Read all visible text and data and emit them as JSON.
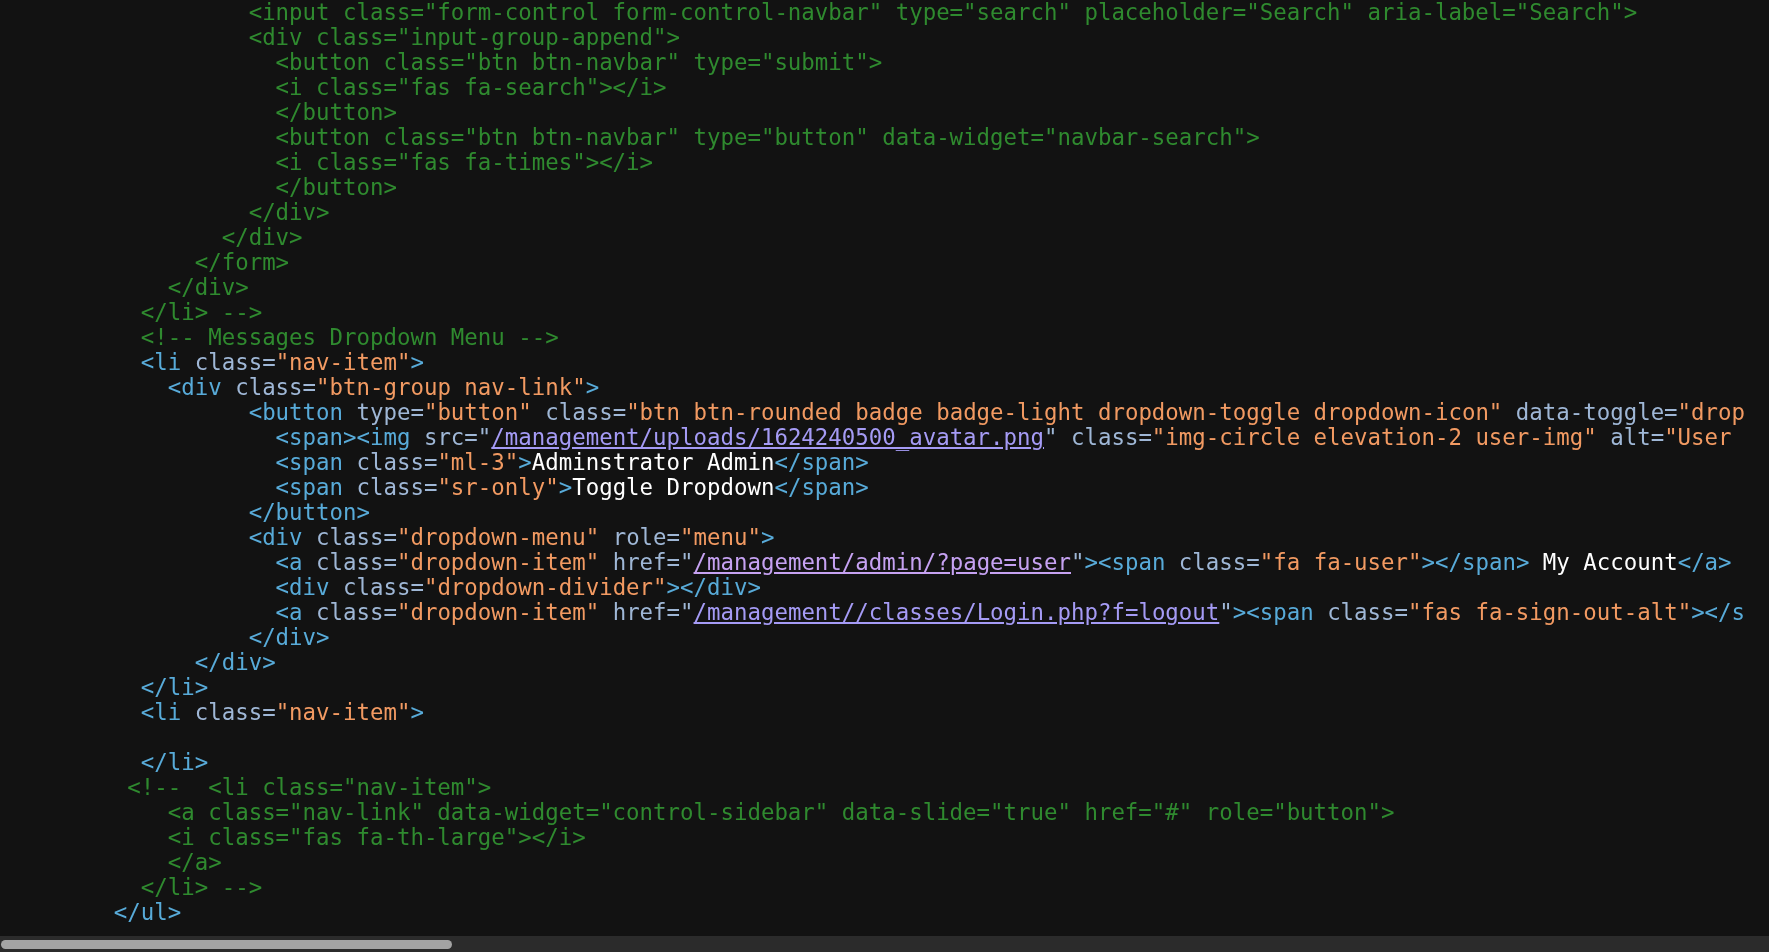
{
  "source_view": {
    "lines": [
      {
        "segments": [
          {
            "kind": "comment",
            "text": "                  <input class=\"form-control form-control-navbar\" type=\"search\" placeholder=\"Search\" aria-label=\"Search\">"
          }
        ]
      },
      {
        "segments": [
          {
            "kind": "comment",
            "text": "                  <div class=\"input-group-append\">"
          }
        ]
      },
      {
        "segments": [
          {
            "kind": "comment",
            "text": "                    <button class=\"btn btn-navbar\" type=\"submit\">"
          }
        ]
      },
      {
        "segments": [
          {
            "kind": "comment",
            "text": "                    <i class=\"fas fa-search\"></i>"
          }
        ]
      },
      {
        "segments": [
          {
            "kind": "comment",
            "text": "                    </button>"
          }
        ]
      },
      {
        "segments": [
          {
            "kind": "comment",
            "text": "                    <button class=\"btn btn-navbar\" type=\"button\" data-widget=\"navbar-search\">"
          }
        ]
      },
      {
        "segments": [
          {
            "kind": "comment",
            "text": "                    <i class=\"fas fa-times\"></i>"
          }
        ]
      },
      {
        "segments": [
          {
            "kind": "comment",
            "text": "                    </button>"
          }
        ]
      },
      {
        "segments": [
          {
            "kind": "comment",
            "text": "                  </div>"
          }
        ]
      },
      {
        "segments": [
          {
            "kind": "comment",
            "text": "                </div>"
          }
        ]
      },
      {
        "segments": [
          {
            "kind": "comment",
            "text": "              </form>"
          }
        ]
      },
      {
        "segments": [
          {
            "kind": "comment",
            "text": "            </div>"
          }
        ]
      },
      {
        "segments": [
          {
            "kind": "comment",
            "text": "          </li> -->"
          }
        ]
      },
      {
        "segments": [
          {
            "kind": "comment",
            "text": "          <!-- Messages Dropdown Menu -->"
          }
        ]
      },
      {
        "segments": [
          {
            "kind": "tag",
            "text": "          <li"
          },
          {
            "kind": "attr",
            "text": " class="
          },
          {
            "kind": "value",
            "text": "\"nav-item\""
          },
          {
            "kind": "tag",
            "text": ">"
          }
        ]
      },
      {
        "segments": [
          {
            "kind": "tag",
            "text": "            <div"
          },
          {
            "kind": "attr",
            "text": " class="
          },
          {
            "kind": "value",
            "text": "\"btn-group nav-link\""
          },
          {
            "kind": "tag",
            "text": ">"
          }
        ]
      },
      {
        "segments": [
          {
            "kind": "tag",
            "text": "                  <button"
          },
          {
            "kind": "attr",
            "text": " type="
          },
          {
            "kind": "value",
            "text": "\"button\""
          },
          {
            "kind": "attr",
            "text": " class="
          },
          {
            "kind": "value",
            "text": "\"btn btn-rounded badge badge-light dropdown-toggle dropdown-icon\""
          },
          {
            "kind": "attr",
            "text": " data-toggle="
          },
          {
            "kind": "value",
            "text": "\"drop"
          }
        ]
      },
      {
        "segments": [
          {
            "kind": "tag",
            "text": "                    <span><img"
          },
          {
            "kind": "attr",
            "text": " src=\""
          },
          {
            "kind": "link",
            "text": "/management/uploads/1624240500_avatar.png"
          },
          {
            "kind": "attr",
            "text": "\" class="
          },
          {
            "kind": "value",
            "text": "\"img-circle elevation-2 user-img\""
          },
          {
            "kind": "attr",
            "text": " alt="
          },
          {
            "kind": "value",
            "text": "\"User"
          }
        ]
      },
      {
        "segments": [
          {
            "kind": "tag",
            "text": "                    <span"
          },
          {
            "kind": "attr",
            "text": " class="
          },
          {
            "kind": "value",
            "text": "\"ml-3\""
          },
          {
            "kind": "tag",
            "text": ">"
          },
          {
            "kind": "text",
            "text": "Adminstrator Admin"
          },
          {
            "kind": "tag",
            "text": "</span>"
          }
        ]
      },
      {
        "segments": [
          {
            "kind": "tag",
            "text": "                    <span"
          },
          {
            "kind": "attr",
            "text": " class="
          },
          {
            "kind": "value",
            "text": "\"sr-only\""
          },
          {
            "kind": "tag",
            "text": ">"
          },
          {
            "kind": "text",
            "text": "Toggle Dropdown"
          },
          {
            "kind": "tag",
            "text": "</span>"
          }
        ]
      },
      {
        "segments": [
          {
            "kind": "tag",
            "text": "                  </button>"
          }
        ]
      },
      {
        "segments": [
          {
            "kind": "tag",
            "text": "                  <div"
          },
          {
            "kind": "attr",
            "text": " class="
          },
          {
            "kind": "value",
            "text": "\"dropdown-menu\""
          },
          {
            "kind": "attr",
            "text": " role="
          },
          {
            "kind": "value",
            "text": "\"menu\""
          },
          {
            "kind": "tag",
            "text": ">"
          }
        ]
      },
      {
        "segments": [
          {
            "kind": "tag",
            "text": "                    <a"
          },
          {
            "kind": "attr",
            "text": " class="
          },
          {
            "kind": "value",
            "text": "\"dropdown-item\""
          },
          {
            "kind": "attr",
            "text": " href=\""
          },
          {
            "kind": "visited_link",
            "text": "/management/admin/?page=user"
          },
          {
            "kind": "attr",
            "text": "\""
          },
          {
            "kind": "tag",
            "text": "><span"
          },
          {
            "kind": "attr",
            "text": " class="
          },
          {
            "kind": "value",
            "text": "\"fa fa-user\""
          },
          {
            "kind": "tag",
            "text": "></span>"
          },
          {
            "kind": "text",
            "text": " My Account"
          },
          {
            "kind": "tag",
            "text": "</a>"
          }
        ]
      },
      {
        "segments": [
          {
            "kind": "tag",
            "text": "                    <div"
          },
          {
            "kind": "attr",
            "text": " class="
          },
          {
            "kind": "value",
            "text": "\"dropdown-divider\""
          },
          {
            "kind": "tag",
            "text": "></div>"
          }
        ]
      },
      {
        "segments": [
          {
            "kind": "tag",
            "text": "                    <a"
          },
          {
            "kind": "attr",
            "text": " class="
          },
          {
            "kind": "value",
            "text": "\"dropdown-item\""
          },
          {
            "kind": "attr",
            "text": " href=\""
          },
          {
            "kind": "link",
            "text": "/management//classes/Login.php?f=logout"
          },
          {
            "kind": "attr",
            "text": "\""
          },
          {
            "kind": "tag",
            "text": "><span"
          },
          {
            "kind": "attr",
            "text": " class="
          },
          {
            "kind": "value",
            "text": "\"fas fa-sign-out-alt\""
          },
          {
            "kind": "tag",
            "text": "></s"
          }
        ]
      },
      {
        "segments": [
          {
            "kind": "tag",
            "text": "                  </div>"
          }
        ]
      },
      {
        "segments": [
          {
            "kind": "tag",
            "text": "              </div>"
          }
        ]
      },
      {
        "segments": [
          {
            "kind": "tag",
            "text": "          </li>"
          }
        ]
      },
      {
        "segments": [
          {
            "kind": "tag",
            "text": "          <li"
          },
          {
            "kind": "attr",
            "text": " class="
          },
          {
            "kind": "value",
            "text": "\"nav-item\""
          },
          {
            "kind": "tag",
            "text": ">"
          }
        ]
      },
      {
        "kind": "blank"
      },
      {
        "segments": [
          {
            "kind": "tag",
            "text": "          </li>"
          }
        ]
      },
      {
        "segments": [
          {
            "kind": "comment",
            "text": "         <!--  <li class=\"nav-item\">"
          }
        ]
      },
      {
        "segments": [
          {
            "kind": "comment",
            "text": "            <a class=\"nav-link\" data-widget=\"control-sidebar\" data-slide=\"true\" href=\"#\" role=\"button\">"
          }
        ]
      },
      {
        "segments": [
          {
            "kind": "comment",
            "text": "            <i class=\"fas fa-th-large\"></i>"
          }
        ]
      },
      {
        "segments": [
          {
            "kind": "comment",
            "text": "            </a>"
          }
        ]
      },
      {
        "segments": [
          {
            "kind": "comment",
            "text": "          </li> -->"
          }
        ]
      },
      {
        "segments": [
          {
            "kind": "tag",
            "text": "        </ul>"
          }
        ]
      }
    ]
  }
}
